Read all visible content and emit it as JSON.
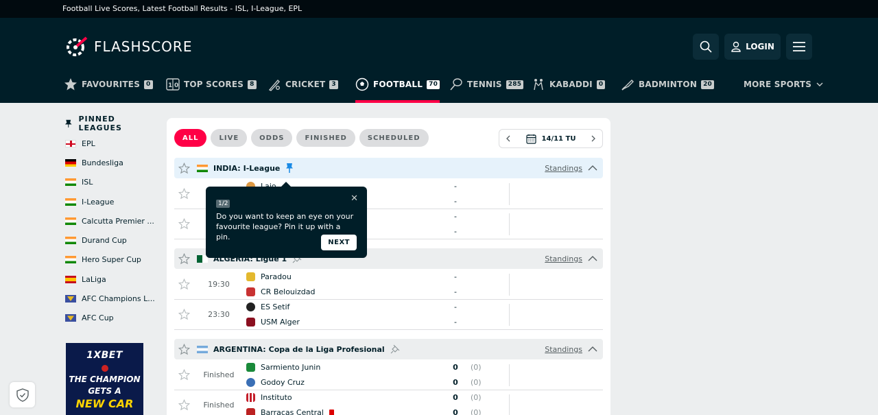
{
  "topbar": {
    "text": "Football Live Scores, Latest Football Results - ISL, I-League, EPL"
  },
  "header": {
    "logo_text": "FLASHSCORE",
    "login_label": "LOGIN",
    "icons": {
      "search": "search-icon",
      "user": "user-icon",
      "menu": "hamburger-icon"
    }
  },
  "sports": [
    {
      "label": "FAVOURITES",
      "count": "0",
      "icon": "star-icon"
    },
    {
      "label": "TOP SCORES",
      "count": "8",
      "icon": "scoreboard-icon"
    },
    {
      "label": "CRICKET",
      "count": "3",
      "icon": "cricket-icon"
    },
    {
      "label": "FOOTBALL",
      "count": "70",
      "icon": "football-icon",
      "active": true
    },
    {
      "label": "TENNIS",
      "count": "285",
      "icon": "tennis-icon"
    },
    {
      "label": "KABADDI",
      "count": "0",
      "icon": "kabaddi-icon"
    },
    {
      "label": "BADMINTON",
      "count": "20",
      "icon": "badminton-icon"
    }
  ],
  "more_sports": "MORE SPORTS",
  "pinned": {
    "title": "PINNED LEAGUES",
    "items": [
      "EPL",
      "Bundesliga",
      "ISL",
      "I-League",
      "Calcutta Premier ...",
      "Durand Cup",
      "Hero Super Cup",
      "LaLiga",
      "AFC Champions L...",
      "AFC Cup"
    ]
  },
  "ad": {
    "brand": "1XBET",
    "line1": "THE CHAMPION",
    "line2": "GETS A",
    "line3": "NEW CAR"
  },
  "filters": {
    "all": "ALL",
    "live": "LIVE",
    "odds": "ODDS",
    "finished": "FINISHED",
    "scheduled": "SCHEDULED"
  },
  "date": "14/11 TU",
  "leagues": [
    {
      "country": "INDIA:",
      "name": "I-League",
      "standings": "Standings",
      "matches": [
        {
          "time": "",
          "home": "Lajo...",
          "away": "",
          "home_score": "-",
          "away_score": "-"
        },
        {
          "time": "",
          "home": "",
          "away": "",
          "home_score": "-",
          "away_score": "-"
        }
      ]
    },
    {
      "country": "ALGERIA:",
      "name": "Ligue 1",
      "standings": "Standings",
      "matches": [
        {
          "time": "19:30",
          "home": "Paradou",
          "away": "CR Belouizdad",
          "home_score": "-",
          "away_score": "-"
        },
        {
          "time": "23:30",
          "home": "ES Setif",
          "away": "USM Alger",
          "home_score": "-",
          "away_score": "-"
        }
      ]
    },
    {
      "country": "ARGENTINA:",
      "name": "Copa de la Liga Profesional",
      "standings": "Standings",
      "matches": [
        {
          "time": "Finished",
          "home": "Sarmiento Junin",
          "away": "Godoy Cruz",
          "home_score": "0",
          "away_score": "0",
          "home_ht": "(0)",
          "away_ht": "(0)"
        },
        {
          "time": "Finished",
          "home": "Instituto",
          "away": "Barracas Central",
          "home_score": "0",
          "away_score": "0",
          "home_ht": "(0)",
          "away_ht": "(0)"
        }
      ]
    }
  ],
  "tooltip": {
    "step": "1/2",
    "message": "Do you want to keep an eye on your favourite league? Pin it up with a pin.",
    "next": "NEXT"
  },
  "colors": {
    "accent": "#ff0046",
    "header_bg": "#001e28",
    "topbar_bg": "#010a0f",
    "page_bg": "#eceeef"
  }
}
